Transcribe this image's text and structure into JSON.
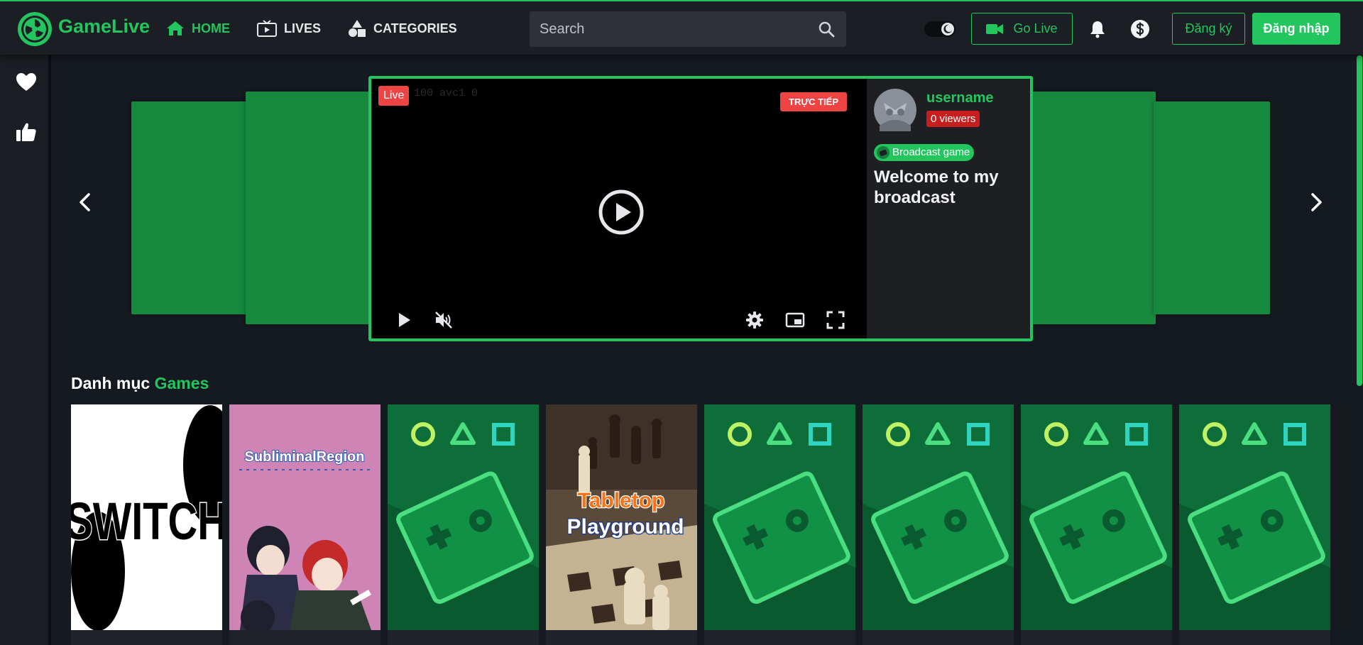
{
  "header": {
    "brand": "GameLive",
    "nav": [
      {
        "label": "HOME",
        "icon": "home-icon",
        "active": true
      },
      {
        "label": "LIVES",
        "icon": "tv-icon",
        "active": false
      },
      {
        "label": "CATEGORIES",
        "icon": "shapes-icon",
        "active": false
      }
    ],
    "search": {
      "placeholder": "Search",
      "value": ""
    },
    "go_live_label": "Go Live",
    "register_label": "Đăng ký",
    "login_label": "Đăng nhập"
  },
  "sidebar": {
    "items": [
      {
        "icon": "heart-icon"
      },
      {
        "icon": "thumbs-up-icon"
      }
    ]
  },
  "featured": {
    "video_overlay_text": "100 avc1 0",
    "live_badge": "Live",
    "truc_tiep_badge": "TRỰC TIẾP",
    "username": "username",
    "viewers": "0 viewers",
    "game_tag": "Broadcast game",
    "title": "Welcome to my broadcast"
  },
  "categories": {
    "title_prefix": "Danh mục",
    "title_highlight": "Games",
    "games": [
      {
        "art": "switch-logo",
        "title": "SWITCH"
      },
      {
        "art": "anime-cover",
        "title_text": "SubliminalRegion"
      },
      {
        "art": "placeholder-controller"
      },
      {
        "art": "chess-cover",
        "title_line1": "Tabletop",
        "title_line2": "Playground"
      },
      {
        "art": "placeholder-controller"
      },
      {
        "art": "placeholder-controller"
      },
      {
        "art": "placeholder-controller"
      },
      {
        "art": "placeholder-controller"
      }
    ]
  },
  "colors": {
    "accent": "#22c55e",
    "live_red": "#ef4444",
    "header_bg": "#1b1e22",
    "page_bg": "#151a21"
  }
}
